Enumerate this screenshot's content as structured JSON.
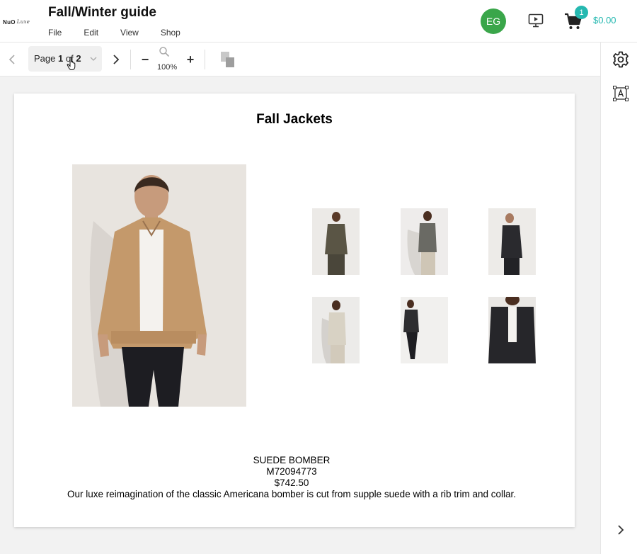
{
  "app": {
    "logo_text": "NuO",
    "logo_script": "Luxe",
    "doc_title": "Fall/Winter guide",
    "menu": [
      "File",
      "Edit",
      "View",
      "Shop"
    ],
    "user_initials": "EG",
    "cart_count": "1",
    "cart_total": "$0.00",
    "accent_color": "#25b8b0",
    "avatar_color": "#3aa64a"
  },
  "toolbar": {
    "page_prefix": "Page",
    "page_current": "1",
    "page_of": "of",
    "page_total": "2",
    "zoom_level": "100%"
  },
  "page": {
    "title": "Fall Jackets",
    "product": {
      "name": "SUEDE BOMBER",
      "sku": "M72094773",
      "price": "$742.50",
      "description": "Our luxe reimagination of the classic Americana bomber is cut from supple suede with a rib trim and collar."
    }
  },
  "icons": {
    "prev": "chevron-left-icon",
    "next": "chevron-right-icon",
    "zoom": "magnifier-icon",
    "present": "presentation-play-icon",
    "cart": "cart-icon",
    "settings": "gear-icon",
    "text": "text-box-icon",
    "expand": "chevron-right-icon"
  }
}
